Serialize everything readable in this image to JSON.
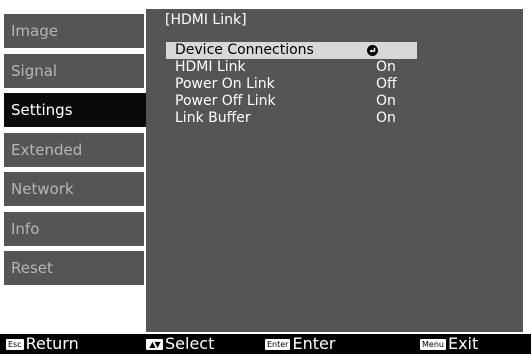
{
  "sidebar": {
    "items": [
      {
        "label": "Image"
      },
      {
        "label": "Signal"
      },
      {
        "label": "Settings",
        "selected": true
      },
      {
        "label": "Extended"
      },
      {
        "label": "Network"
      },
      {
        "label": "Info"
      },
      {
        "label": "Reset"
      }
    ]
  },
  "panel": {
    "title": "[HDMI Link]",
    "rows": [
      {
        "label": "Device Connections",
        "value": "",
        "icon": "enter-icon"
      },
      {
        "label": "HDMI Link",
        "value": "On"
      },
      {
        "label": "Power On Link",
        "value": "Off"
      },
      {
        "label": "Power Off Link",
        "value": "On"
      },
      {
        "label": "Link Buffer",
        "value": "On"
      }
    ]
  },
  "footer": {
    "return": {
      "key": "Esc",
      "label": "Return"
    },
    "select": {
      "key": "▲▼",
      "label": "Select"
    },
    "enter": {
      "key": "Enter",
      "label": "Enter"
    },
    "exit": {
      "key": "Menu",
      "label": "Exit"
    }
  },
  "colors": {
    "sidebar_bg": "#555555",
    "sidebar_selected_bg": "#0a0a0a",
    "panel_bg": "#555555",
    "highlight_bg": "#d8d8d8",
    "footer_bg": "#000000"
  }
}
